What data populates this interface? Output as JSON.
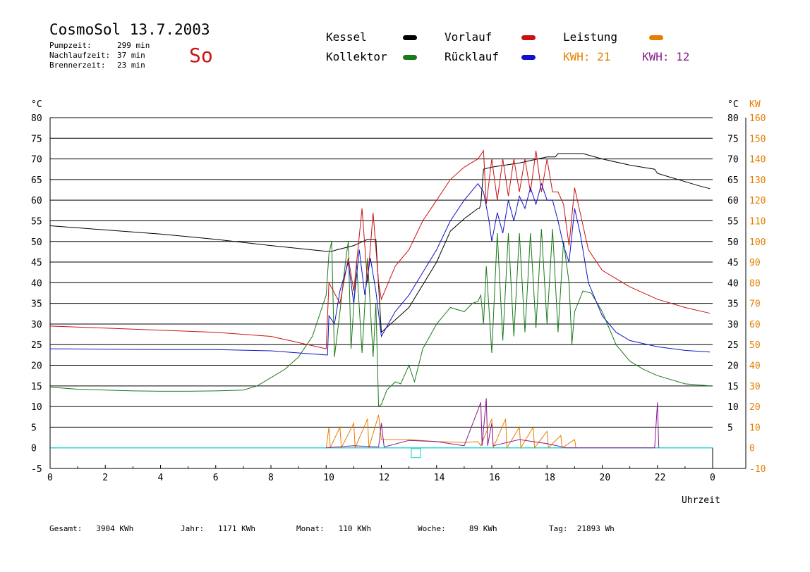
{
  "header": {
    "title": "CosmoSol 13.7.2003",
    "day": "So",
    "stats": [
      {
        "label": "Pumpzeit:",
        "value": "299 min"
      },
      {
        "label": "Nachlaufzeit:",
        "value": "37 min"
      },
      {
        "label": "Brennerzeit:",
        "value": "23 min"
      }
    ]
  },
  "legend": {
    "kessel": "Kessel",
    "kollektor": "Kollektor",
    "vorlauf": "Vorlauf",
    "ruecklauf": "Rücklauf",
    "leistung": "Leistung",
    "kwh1": "KWH: 21",
    "kwh2": "KWH: 12"
  },
  "colors": {
    "kessel": "#000000",
    "kollektor": "#1a7a1a",
    "vorlauf": "#cc1111",
    "ruecklauf": "#1111cc",
    "leistung": "#e67e00",
    "kwh2": "#8a1a8a",
    "baseline": "#33d6d6"
  },
  "footer": [
    {
      "label": "Gesamt:",
      "value": "3904 KWh"
    },
    {
      "label": "Jahr:",
      "value": "1171 KWh"
    },
    {
      "label": "Monat:",
      "value": "110 KWh"
    },
    {
      "label": "Woche:",
      "value": "89 KWh"
    },
    {
      "label": "Tag:",
      "value": "21893 Wh"
    }
  ],
  "chart_data": {
    "type": "line",
    "title": "CosmoSol 13.7.2003",
    "xlabel": "Uhrzeit",
    "ylabel": "°C",
    "ylabel_right": "KW",
    "xlim": [
      0,
      24
    ],
    "ylim": [
      -5,
      80
    ],
    "ylim_right": [
      -10,
      160
    ],
    "x_ticks": [
      0,
      2,
      4,
      6,
      8,
      10,
      12,
      14,
      16,
      18,
      20,
      22,
      0
    ],
    "y_ticks": [
      80,
      75,
      70,
      65,
      60,
      55,
      50,
      45,
      40,
      35,
      30,
      25,
      20,
      15,
      10,
      5,
      0,
      -5
    ],
    "y_ticks_right": [
      160,
      150,
      140,
      130,
      120,
      110,
      100,
      90,
      80,
      70,
      60,
      50,
      40,
      30,
      20,
      10,
      0,
      -10
    ],
    "grid": "horizontal",
    "series": [
      {
        "name": "Kessel",
        "color": "#000000",
        "points": [
          [
            0,
            53.8
          ],
          [
            2,
            52.8
          ],
          [
            4,
            51.8
          ],
          [
            6,
            50.5
          ],
          [
            8,
            49
          ],
          [
            10,
            47.6
          ],
          [
            10.2,
            47.6
          ],
          [
            10.4,
            48
          ],
          [
            11,
            49
          ],
          [
            11.5,
            50.5
          ],
          [
            11.8,
            50.5
          ],
          [
            12,
            28
          ],
          [
            12.5,
            31
          ],
          [
            13,
            34
          ],
          [
            14,
            45
          ],
          [
            14.5,
            52.5
          ],
          [
            15,
            55.5
          ],
          [
            15.5,
            58
          ],
          [
            15.55,
            58
          ],
          [
            15.6,
            59
          ],
          [
            15.7,
            67.5
          ],
          [
            16,
            68
          ],
          [
            17,
            69
          ],
          [
            18,
            70.5
          ],
          [
            18.3,
            70.5
          ],
          [
            18.4,
            71.3
          ],
          [
            19.3,
            71.3
          ],
          [
            20,
            70
          ],
          [
            21,
            68.5
          ],
          [
            21.9,
            67.5
          ],
          [
            22,
            66.5
          ],
          [
            22.5,
            65.5
          ],
          [
            23,
            64.5
          ],
          [
            23.5,
            63.5
          ],
          [
            23.9,
            62.8
          ]
        ]
      },
      {
        "name": "Kollektor",
        "color": "#1a7a1a",
        "points": [
          [
            0,
            14.7
          ],
          [
            1,
            14.2
          ],
          [
            2,
            14
          ],
          [
            3,
            13.8
          ],
          [
            4,
            13.7
          ],
          [
            5,
            13.7
          ],
          [
            6,
            13.8
          ],
          [
            7,
            14
          ],
          [
            7.5,
            15
          ],
          [
            8,
            17
          ],
          [
            8.5,
            19
          ],
          [
            9,
            22
          ],
          [
            9.5,
            27
          ],
          [
            9.8,
            33
          ],
          [
            10,
            37
          ],
          [
            10.1,
            47
          ],
          [
            10.2,
            50
          ],
          [
            10.3,
            22
          ],
          [
            10.5,
            33
          ],
          [
            10.7,
            45
          ],
          [
            10.8,
            50
          ],
          [
            10.9,
            24
          ],
          [
            11.1,
            45
          ],
          [
            11.3,
            23
          ],
          [
            11.5,
            46
          ],
          [
            11.7,
            22
          ],
          [
            11.8,
            35
          ],
          [
            11.9,
            10
          ],
          [
            12,
            10.5
          ],
          [
            12.2,
            14
          ],
          [
            12.5,
            16
          ],
          [
            12.7,
            15.5
          ],
          [
            13,
            20
          ],
          [
            13.2,
            16
          ],
          [
            13.5,
            24
          ],
          [
            14,
            30
          ],
          [
            14.5,
            34
          ],
          [
            15,
            33
          ],
          [
            15.3,
            35
          ],
          [
            15.5,
            35.5
          ],
          [
            15.6,
            37
          ],
          [
            15.7,
            30
          ],
          [
            15.8,
            44
          ],
          [
            16,
            23
          ],
          [
            16.2,
            52
          ],
          [
            16.4,
            26
          ],
          [
            16.6,
            52
          ],
          [
            16.8,
            27
          ],
          [
            17,
            52
          ],
          [
            17.2,
            28
          ],
          [
            17.4,
            52
          ],
          [
            17.6,
            29
          ],
          [
            17.8,
            53
          ],
          [
            18,
            30
          ],
          [
            18.2,
            53
          ],
          [
            18.4,
            28
          ],
          [
            18.6,
            50
          ],
          [
            18.8,
            40
          ],
          [
            18.9,
            25
          ],
          [
            19,
            33
          ],
          [
            19.3,
            38
          ],
          [
            19.6,
            37.5
          ],
          [
            20,
            33
          ],
          [
            20.5,
            25
          ],
          [
            21,
            21
          ],
          [
            21.5,
            19
          ],
          [
            22,
            17.5
          ],
          [
            23,
            15.5
          ],
          [
            23.9,
            15
          ]
        ]
      },
      {
        "name": "Vorlauf",
        "color": "#cc1111",
        "points": [
          [
            0,
            29.5
          ],
          [
            2,
            29
          ],
          [
            4,
            28.5
          ],
          [
            6,
            28
          ],
          [
            8,
            27
          ],
          [
            10,
            24
          ],
          [
            10.1,
            40
          ],
          [
            10.5,
            35
          ],
          [
            10.8,
            46
          ],
          [
            11,
            38
          ],
          [
            11.3,
            58
          ],
          [
            11.5,
            40
          ],
          [
            11.7,
            57
          ],
          [
            11.9,
            40
          ],
          [
            12,
            36
          ],
          [
            12.5,
            44
          ],
          [
            13,
            48
          ],
          [
            13.5,
            55
          ],
          [
            14,
            60
          ],
          [
            14.5,
            65
          ],
          [
            15,
            68
          ],
          [
            15.5,
            70
          ],
          [
            15.7,
            72
          ],
          [
            15.8,
            59
          ],
          [
            16,
            70
          ],
          [
            16.2,
            60
          ],
          [
            16.4,
            70
          ],
          [
            16.6,
            61
          ],
          [
            16.8,
            70
          ],
          [
            17,
            62
          ],
          [
            17.2,
            70
          ],
          [
            17.4,
            62
          ],
          [
            17.6,
            72
          ],
          [
            17.8,
            62
          ],
          [
            18,
            70
          ],
          [
            18.2,
            62
          ],
          [
            18.4,
            62
          ],
          [
            18.6,
            59
          ],
          [
            18.8,
            49
          ],
          [
            19,
            63
          ],
          [
            19.2,
            57
          ],
          [
            19.5,
            48
          ],
          [
            20,
            43
          ],
          [
            21,
            39
          ],
          [
            22,
            36
          ],
          [
            23,
            34
          ],
          [
            23.9,
            32.6
          ]
        ]
      },
      {
        "name": "Rücklauf",
        "color": "#1111cc",
        "points": [
          [
            0,
            24
          ],
          [
            2,
            23.9
          ],
          [
            4,
            23.8
          ],
          [
            6,
            23.8
          ],
          [
            8,
            23.5
          ],
          [
            9,
            23
          ],
          [
            10,
            22.5
          ],
          [
            10.05,
            22.5
          ],
          [
            10.1,
            32
          ],
          [
            10.3,
            30
          ],
          [
            10.5,
            38
          ],
          [
            10.8,
            45
          ],
          [
            11,
            35
          ],
          [
            11.2,
            48
          ],
          [
            11.4,
            37
          ],
          [
            11.6,
            46
          ],
          [
            11.8,
            38
          ],
          [
            12,
            27
          ],
          [
            12.5,
            33
          ],
          [
            13,
            37
          ],
          [
            14,
            48
          ],
          [
            14.5,
            55
          ],
          [
            15,
            60
          ],
          [
            15.5,
            64
          ],
          [
            15.7,
            62
          ],
          [
            15.9,
            55
          ],
          [
            16,
            50
          ],
          [
            16.2,
            57
          ],
          [
            16.4,
            52
          ],
          [
            16.6,
            60
          ],
          [
            16.8,
            55
          ],
          [
            17,
            61
          ],
          [
            17.2,
            58
          ],
          [
            17.4,
            63
          ],
          [
            17.6,
            59
          ],
          [
            17.8,
            64
          ],
          [
            18,
            60
          ],
          [
            18.2,
            60
          ],
          [
            18.4,
            55
          ],
          [
            18.6,
            49
          ],
          [
            18.8,
            45
          ],
          [
            19,
            58
          ],
          [
            19.2,
            52
          ],
          [
            19.5,
            40
          ],
          [
            20,
            32
          ],
          [
            20.5,
            28
          ],
          [
            21,
            26
          ],
          [
            22,
            24.5
          ],
          [
            23,
            23.6
          ],
          [
            23.9,
            23.2
          ]
        ]
      },
      {
        "name": "Leistung",
        "color": "#e67e00",
        "points": [
          [
            10,
            0
          ],
          [
            10.1,
            5
          ],
          [
            10.15,
            0
          ],
          [
            10.5,
            5
          ],
          [
            10.55,
            0
          ],
          [
            11,
            6
          ],
          [
            11.05,
            0
          ],
          [
            11.5,
            7
          ],
          [
            11.55,
            0
          ],
          [
            11.9,
            8
          ],
          [
            12,
            2
          ],
          [
            13,
            2
          ],
          [
            14,
            1.5
          ],
          [
            15,
            1.3
          ],
          [
            15.5,
            1.5
          ],
          [
            15.6,
            0.5
          ],
          [
            16,
            7
          ],
          [
            16.05,
            0
          ],
          [
            16.5,
            7
          ],
          [
            16.55,
            0
          ],
          [
            17,
            5
          ],
          [
            17.05,
            0
          ],
          [
            17.5,
            5
          ],
          [
            17.55,
            0
          ],
          [
            18,
            4
          ],
          [
            18.05,
            0
          ],
          [
            18.5,
            3
          ],
          [
            18.55,
            0
          ],
          [
            19,
            2
          ],
          [
            19.05,
            0
          ]
        ]
      },
      {
        "name": "KWH 2",
        "color": "#8a1a8a",
        "points": [
          [
            10,
            0
          ],
          [
            11,
            0.5
          ],
          [
            11.9,
            0.2
          ],
          [
            12,
            6
          ],
          [
            12.1,
            0.2
          ],
          [
            13,
            1.8
          ],
          [
            14,
            1.5
          ],
          [
            15,
            0.5
          ],
          [
            15.6,
            11
          ],
          [
            15.65,
            0.5
          ],
          [
            15.8,
            12
          ],
          [
            15.85,
            0.5
          ],
          [
            16,
            6
          ],
          [
            16.05,
            0.5
          ],
          [
            17,
            2
          ],
          [
            18,
            1
          ],
          [
            18.7,
            0
          ],
          [
            21.9,
            0
          ],
          [
            22,
            11
          ],
          [
            22.05,
            0
          ]
        ]
      }
    ]
  }
}
